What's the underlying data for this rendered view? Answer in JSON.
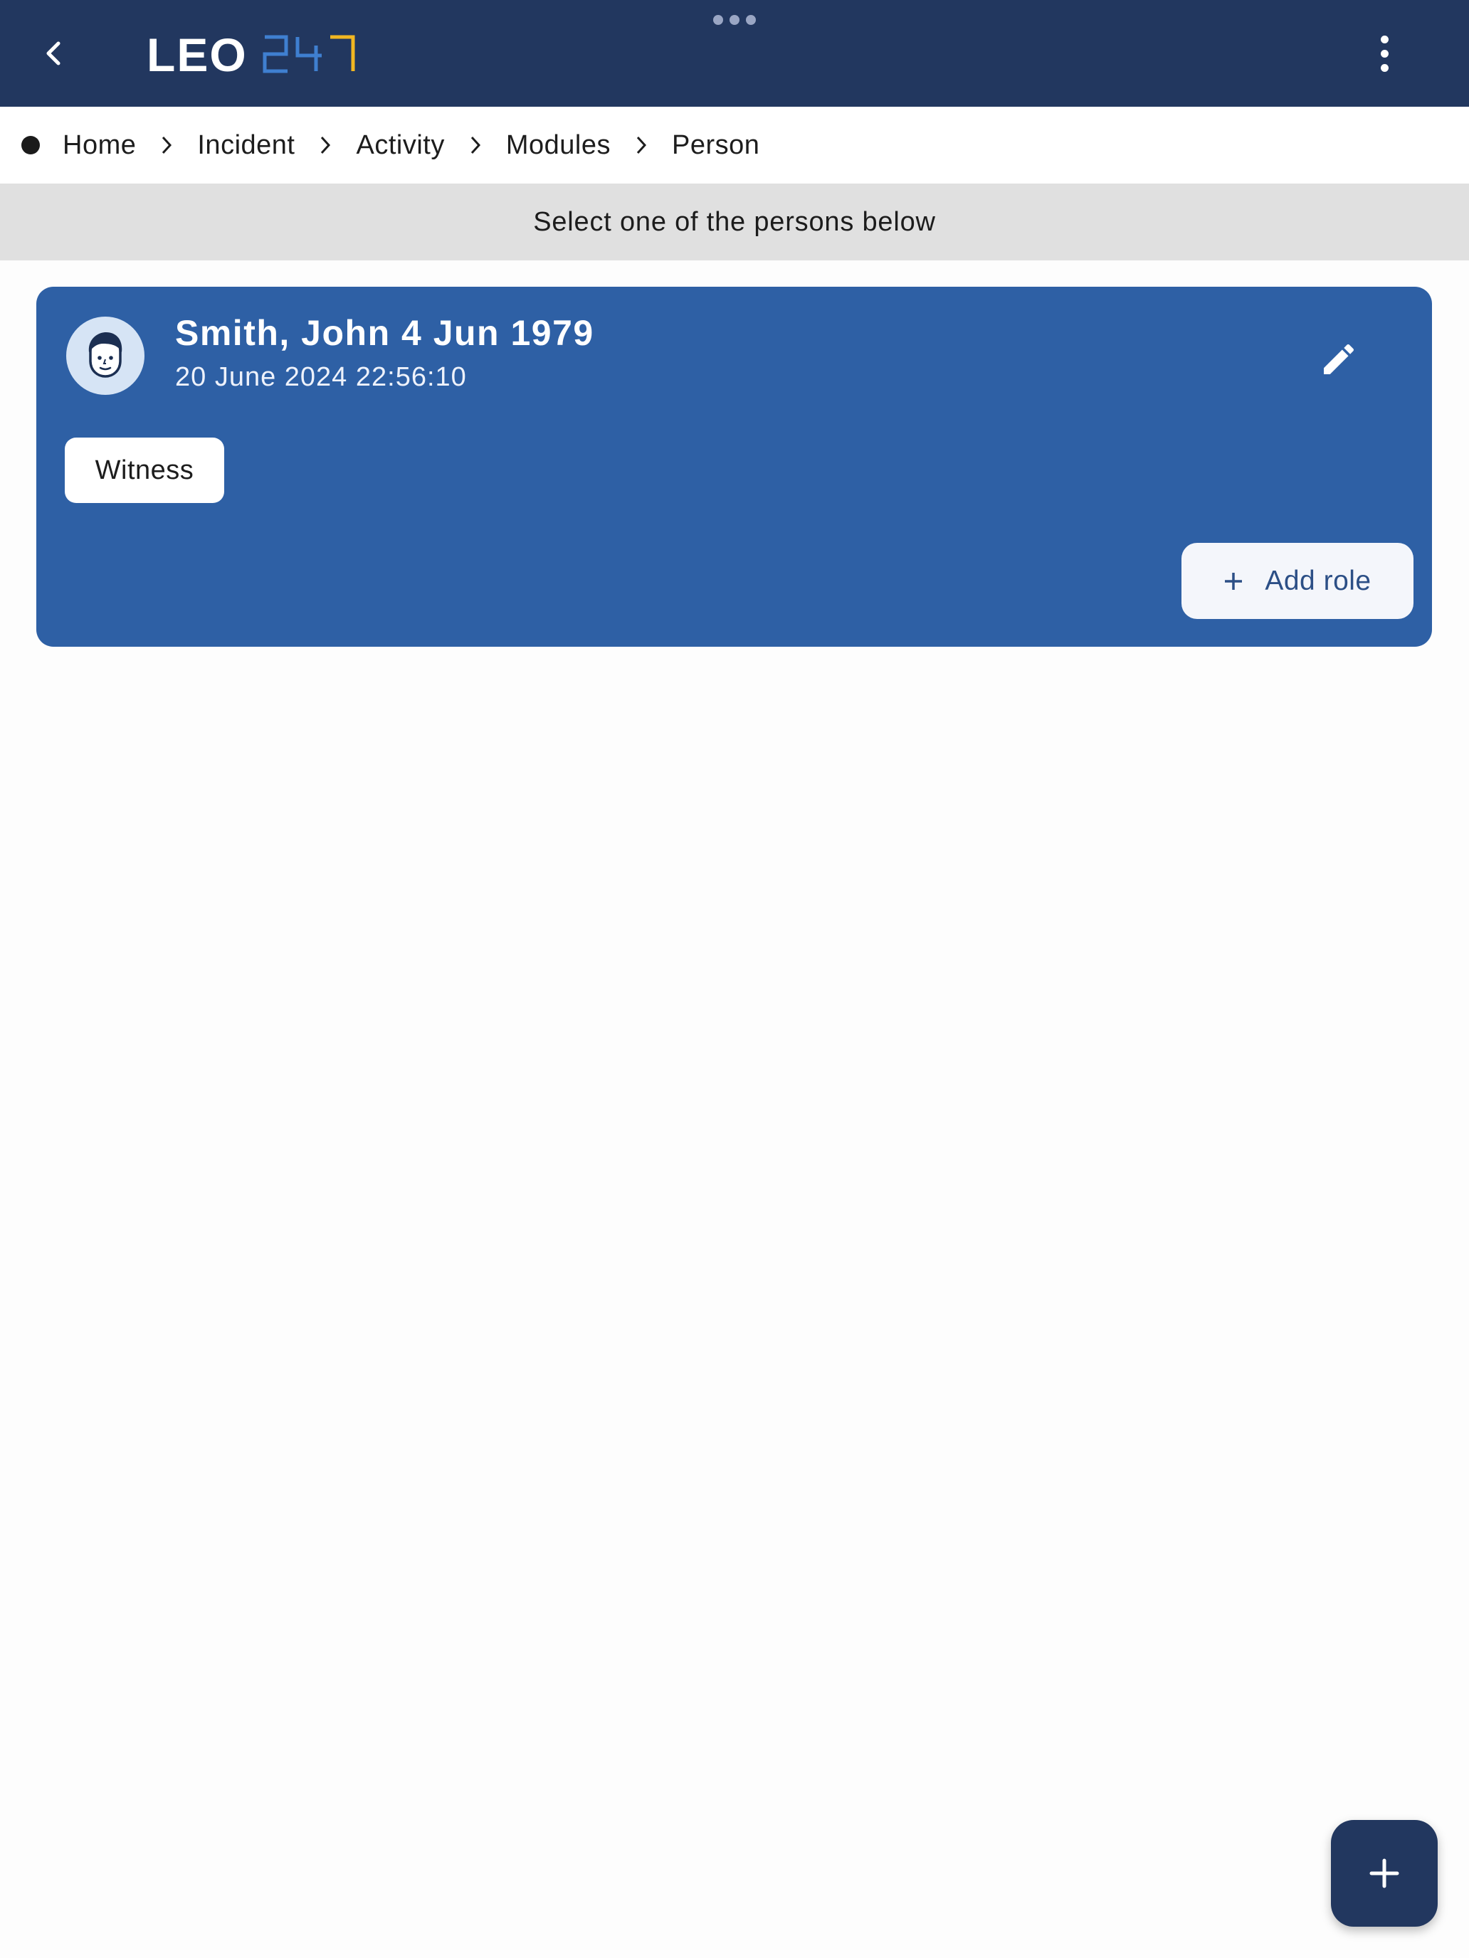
{
  "appbar": {
    "logo_text_left": "LEO",
    "logo_text_right": "247",
    "logo_colors": {
      "left": "#ffffff",
      "digits": "#3f7fd0",
      "accent": "#f2b722"
    },
    "background": "#22375f"
  },
  "breadcrumb": {
    "items": [
      {
        "label": "Home"
      },
      {
        "label": "Incident"
      },
      {
        "label": "Activity"
      },
      {
        "label": "Modules"
      },
      {
        "label": "Person"
      }
    ]
  },
  "instruction": "Select one of the persons below",
  "person_card": {
    "name": "Smith, John 4 Jun 1979",
    "timestamp": "20 June 2024 22:56:10",
    "role": "Witness",
    "add_role_label": "Add role",
    "background": "#2e60a5"
  },
  "icons": {
    "back": "chevron-left-icon",
    "menu": "more-vertical-icon",
    "edit": "pencil-icon",
    "avatar": "person-face-icon",
    "add": "plus-icon"
  }
}
